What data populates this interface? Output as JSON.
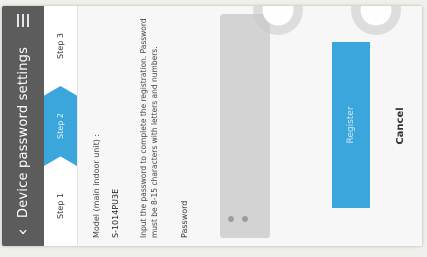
{
  "header": {
    "back_icon": "chevron-left-icon",
    "title": "Device password settings",
    "menu_icon": "hamburger-menu-icon"
  },
  "steps": [
    {
      "label": "Step 1",
      "active": false
    },
    {
      "label": "Step 2",
      "active": true
    },
    {
      "label": "Step 3",
      "active": false
    }
  ],
  "form": {
    "model_label": "Model (main indoor unit) :",
    "model_value": "S-1014PU3E",
    "instructions": "Input the password to complete the registration. Password must be 8-15 characters with letters and numbers.",
    "password_label": "Password"
  },
  "buttons": {
    "register": "Register",
    "cancel": "Cancel"
  },
  "colors": {
    "accent": "#3aa6dc",
    "header_bg": "#5c5c5c",
    "input_bg": "#d3d3d3"
  }
}
